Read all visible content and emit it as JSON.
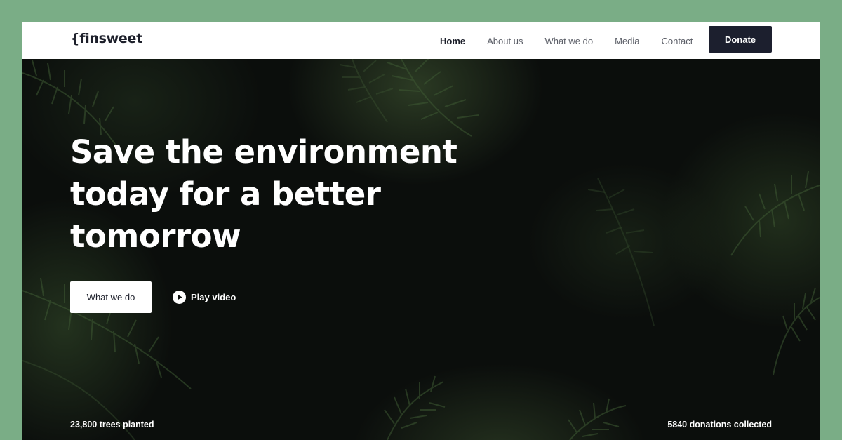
{
  "header": {
    "logo": "{finsweet",
    "nav": [
      {
        "label": "Home",
        "active": true
      },
      {
        "label": "About us",
        "active": false
      },
      {
        "label": "What we do",
        "active": false
      },
      {
        "label": "Media",
        "active": false
      },
      {
        "label": "Contact",
        "active": false
      }
    ],
    "donate_label": "Donate"
  },
  "hero": {
    "title_lines": [
      "Save the environment",
      "today for a better",
      "tomorrow"
    ],
    "primary_button": "What we do",
    "play_label": "Play video",
    "stats": {
      "left": "23,800 trees planted",
      "right": "5840 donations collected"
    }
  },
  "colors": {
    "page_bg": "#7aad86",
    "header_bg": "#ffffff",
    "donate_bg": "#1c1f2e",
    "hero_bg": "#0b0e0c",
    "leaf": "#3e5a34"
  },
  "icons": [
    "play-icon"
  ]
}
